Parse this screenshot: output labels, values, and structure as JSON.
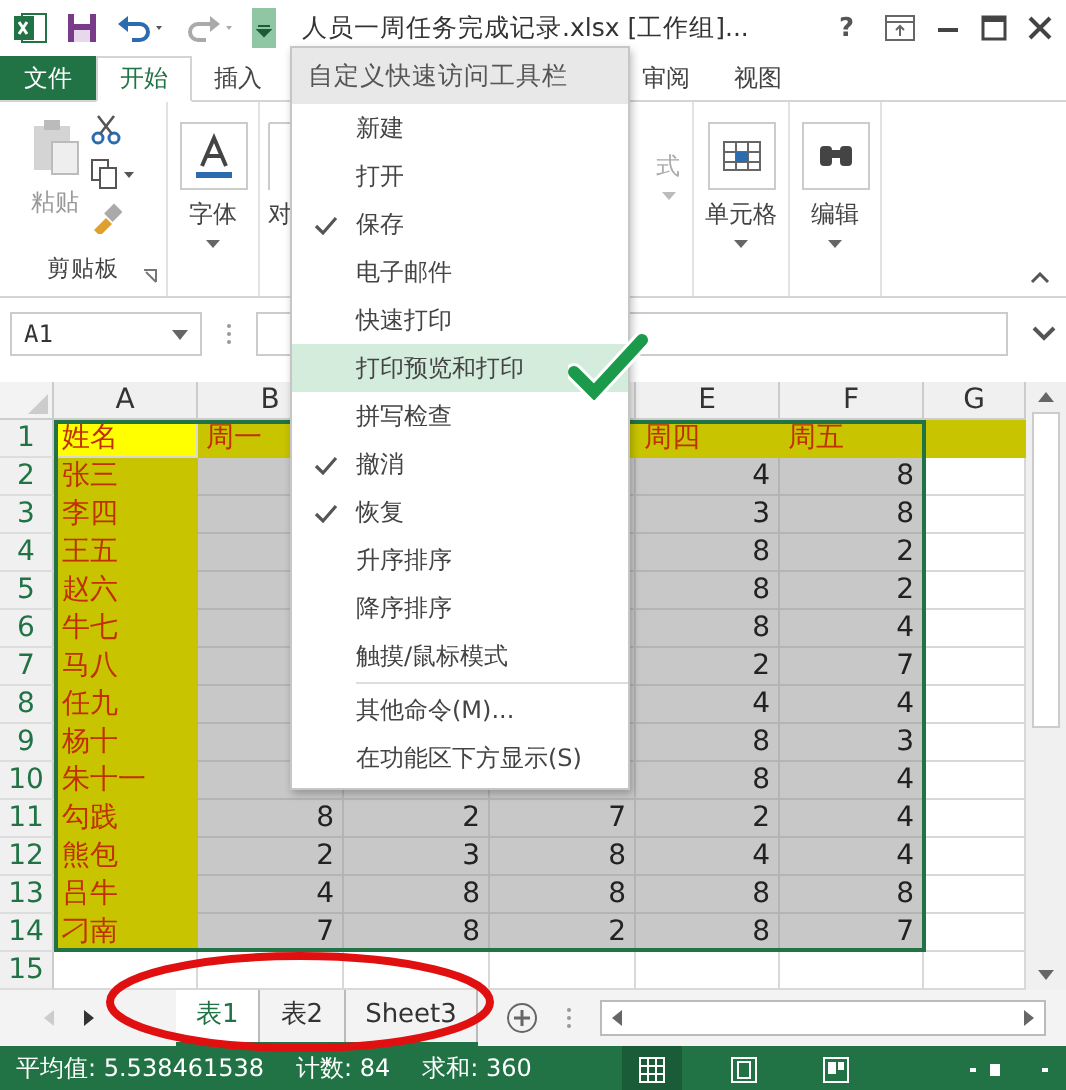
{
  "window": {
    "title": "人员一周任务完成记录.xlsx  [工作组]...",
    "help": "?"
  },
  "ribbon": {
    "tabs": [
      {
        "label": "文件",
        "kind": "file",
        "selected": false
      },
      {
        "label": "开始",
        "kind": "tab",
        "selected": true
      },
      {
        "label": "插入",
        "kind": "tab",
        "selected": false
      },
      {
        "label": "审阅",
        "kind": "tab",
        "selected": false
      },
      {
        "label": "视图",
        "kind": "tab",
        "selected": false
      }
    ],
    "groups": [
      {
        "kind": "clipboard",
        "label": "剪贴板",
        "button": "粘贴",
        "disabled": true
      },
      {
        "kind": "font",
        "button": "字体",
        "disabled": false
      },
      {
        "kind": "partial",
        "button": "对",
        "disabled": false
      },
      {
        "kind": "faded",
        "button": "式",
        "disabled": true
      },
      {
        "kind": "cells",
        "button": "单元格",
        "disabled": false
      },
      {
        "kind": "find",
        "button": "编辑",
        "disabled": false
      }
    ]
  },
  "name_box": "A1",
  "sheet": {
    "columns": [
      "A",
      "B",
      null,
      null,
      "E",
      "F",
      "G"
    ],
    "rows": [
      {
        "header": "1",
        "cells": [
          "姓名",
          "周一",
          null,
          null,
          "周四",
          "周五"
        ]
      },
      {
        "header": "2",
        "cells": [
          "张三",
          null,
          null,
          null,
          "4",
          "8"
        ]
      },
      {
        "header": "3",
        "cells": [
          "李四",
          null,
          null,
          null,
          "3",
          "8"
        ]
      },
      {
        "header": "4",
        "cells": [
          "王五",
          null,
          null,
          null,
          "8",
          "2"
        ]
      },
      {
        "header": "5",
        "cells": [
          "赵六",
          null,
          null,
          null,
          "8",
          "2"
        ]
      },
      {
        "header": "6",
        "cells": [
          "牛七",
          null,
          null,
          null,
          "8",
          "4"
        ]
      },
      {
        "header": "7",
        "cells": [
          "马八",
          null,
          null,
          null,
          "2",
          "7"
        ]
      },
      {
        "header": "8",
        "cells": [
          "任九",
          null,
          null,
          null,
          "4",
          "4"
        ]
      },
      {
        "header": "9",
        "cells": [
          "杨十",
          null,
          null,
          null,
          "8",
          "3"
        ]
      },
      {
        "header": "10",
        "cells": [
          "朱十一",
          null,
          null,
          null,
          "8",
          "4"
        ]
      },
      {
        "header": "11",
        "cells": [
          "勾践",
          "8",
          "2",
          "7",
          "2",
          "4"
        ]
      },
      {
        "header": "12",
        "cells": [
          "熊包",
          "2",
          "3",
          "8",
          "4",
          "4"
        ]
      },
      {
        "header": "13",
        "cells": [
          "吕牛",
          "4",
          "8",
          "8",
          "8",
          "8"
        ]
      },
      {
        "header": "14",
        "cells": [
          "刁南",
          "7",
          "8",
          "2",
          "8",
          "7"
        ]
      },
      {
        "header": "15"
      }
    ]
  },
  "sheet_tabs": [
    {
      "label": "表1",
      "selected": true
    },
    {
      "label": "表2",
      "selected": false
    },
    {
      "label": "Sheet3",
      "selected": false
    }
  ],
  "status_bar": {
    "items": [
      "平均值: 5.538461538",
      "计数: 84",
      "求和: 360"
    ],
    "views": [
      {
        "kind": "normal",
        "selected": true
      },
      {
        "kind": "layout",
        "selected": false
      },
      {
        "kind": "pagebreak",
        "selected": false
      }
    ]
  },
  "menu": {
    "title": "自定义快速访问工具栏",
    "items": [
      {
        "label": "新建",
        "kind": "option",
        "checked": false,
        "selected": false
      },
      {
        "label": "打开",
        "kind": "option",
        "checked": false,
        "selected": false
      },
      {
        "label": "保存",
        "kind": "option",
        "checked": true,
        "selected": false
      },
      {
        "label": "电子邮件",
        "kind": "option",
        "checked": false,
        "selected": false
      },
      {
        "label": "快速打印",
        "kind": "option",
        "checked": false,
        "selected": false
      },
      {
        "label": "打印预览和打印",
        "kind": "option",
        "checked": false,
        "selected": true
      },
      {
        "label": "拼写检查",
        "kind": "option",
        "checked": false,
        "selected": false
      },
      {
        "label": "撤消",
        "kind": "option",
        "checked": true,
        "selected": false
      },
      {
        "label": "恢复",
        "kind": "option",
        "checked": true,
        "selected": false
      },
      {
        "label": "升序排序",
        "kind": "option",
        "checked": false,
        "selected": false
      },
      {
        "label": "降序排序",
        "kind": "option",
        "checked": false,
        "selected": false
      },
      {
        "label": "触摸/鼠标模式",
        "kind": "option",
        "checked": false,
        "selected": false
      },
      {
        "label": "其他命令(M)...",
        "kind": "command",
        "checked": false,
        "selected": false
      },
      {
        "label": "在功能区下方显示(S)",
        "kind": "command",
        "checked": false,
        "selected": false
      }
    ]
  }
}
